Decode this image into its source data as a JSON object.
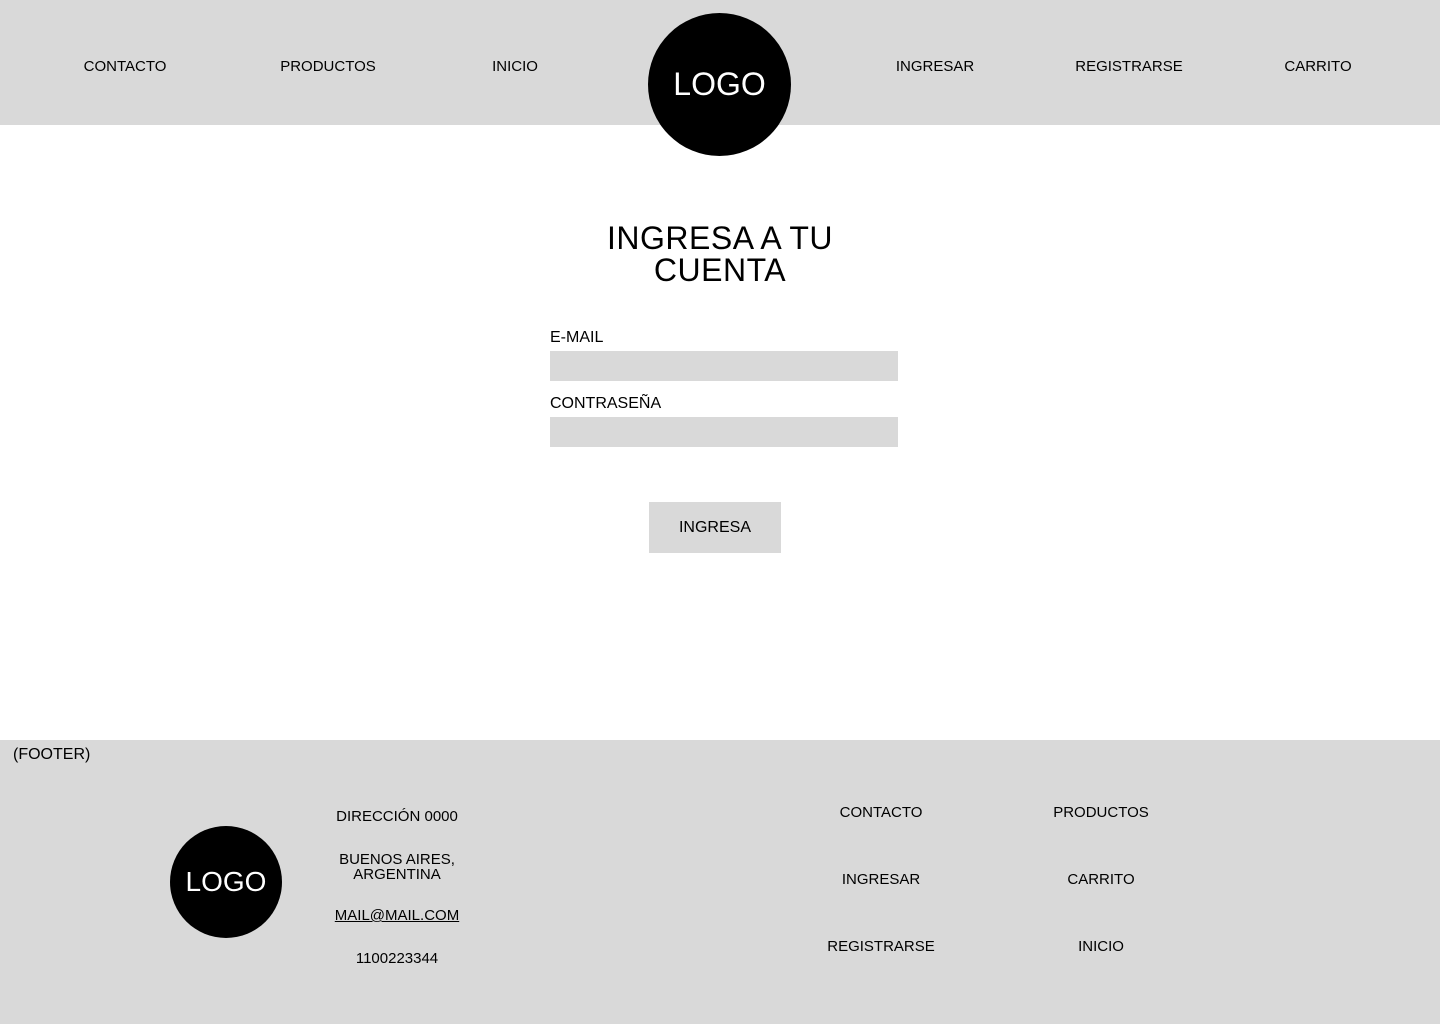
{
  "header": {
    "nav_left": [
      "CONTACTO",
      "PRODUCTOS",
      "INICIO"
    ],
    "logo": "LOGO",
    "nav_right": [
      "INGRESAR",
      "REGISTRARSE",
      "CARRITO"
    ]
  },
  "login": {
    "title_line1": "INGRESA A TU",
    "title_line2": "CUENTA",
    "email_label": "E-MAIL",
    "email_value": "",
    "password_label": "CONTRASEÑA",
    "password_value": "",
    "submit_label": "INGRESA"
  },
  "footer": {
    "tag": "(FOOTER)",
    "logo": "LOGO",
    "address": "DIRECCIÓN 0000",
    "city_line1": "BUENOS AIRES,",
    "city_line2": "ARGENTINA",
    "email": "MAIL@MAIL.COM",
    "phone": "1100223344",
    "links": [
      "CONTACTO",
      "PRODUCTOS",
      "INGRESAR",
      "CARRITO",
      "REGISTRARSE",
      "INICIO"
    ]
  }
}
